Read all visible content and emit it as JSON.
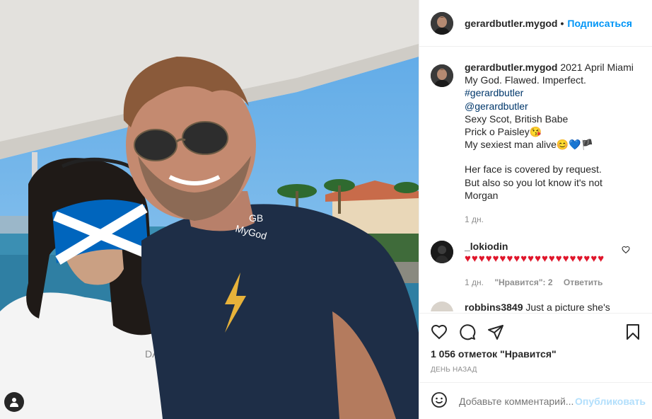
{
  "post": {
    "username": "gerardbutler.mygod",
    "follow_label": "Подписаться",
    "photo_text": {
      "shirt_line1": "GB",
      "shirt_line2": "MyGod",
      "badge": "DA"
    }
  },
  "caption": {
    "username": "gerardbutler.mygod",
    "first_line": " 2021 April Miami",
    "lines": [
      "My God. Flawed. Imperfect.",
      "#gerardbutler",
      "@gerardbutler",
      "Sexy Scot, British Babe",
      "Prick o Paisley😘",
      "My sexiest man alive😊💙🏴",
      "",
      "Her face is covered by request.",
      "But also so you lot know it's not",
      "Morgan"
    ],
    "time_ago": "1 дн."
  },
  "comments": [
    {
      "username": "_lokiodin",
      "text": "♥♥♥♥♥♥♥♥♥♥♥♥♥♥♥♥♥♥♥♥",
      "time_ago": "1 дн.",
      "likes_label": "\"Нравится\": 2",
      "reply_label": "Ответить"
    },
    {
      "username": "robbins3849",
      "text": " Just a picture she's"
    }
  ],
  "actions": {
    "likes_text": "1 056 отметок \"Нравится\"",
    "date_text": "ДЕНЬ НАЗАД"
  },
  "add_comment": {
    "placeholder": "Добавьте комментарий...",
    "publish_label": "Опубликовать"
  },
  "icons": [
    "user-tag-icon",
    "heart-icon",
    "comment-icon",
    "share-icon",
    "bookmark-icon",
    "emoji-icon",
    "comment-like-icon"
  ],
  "colors": {
    "accent": "#0095f6",
    "link": "#00376b",
    "muted": "#8e8e8e",
    "heart": "#e0162b"
  }
}
